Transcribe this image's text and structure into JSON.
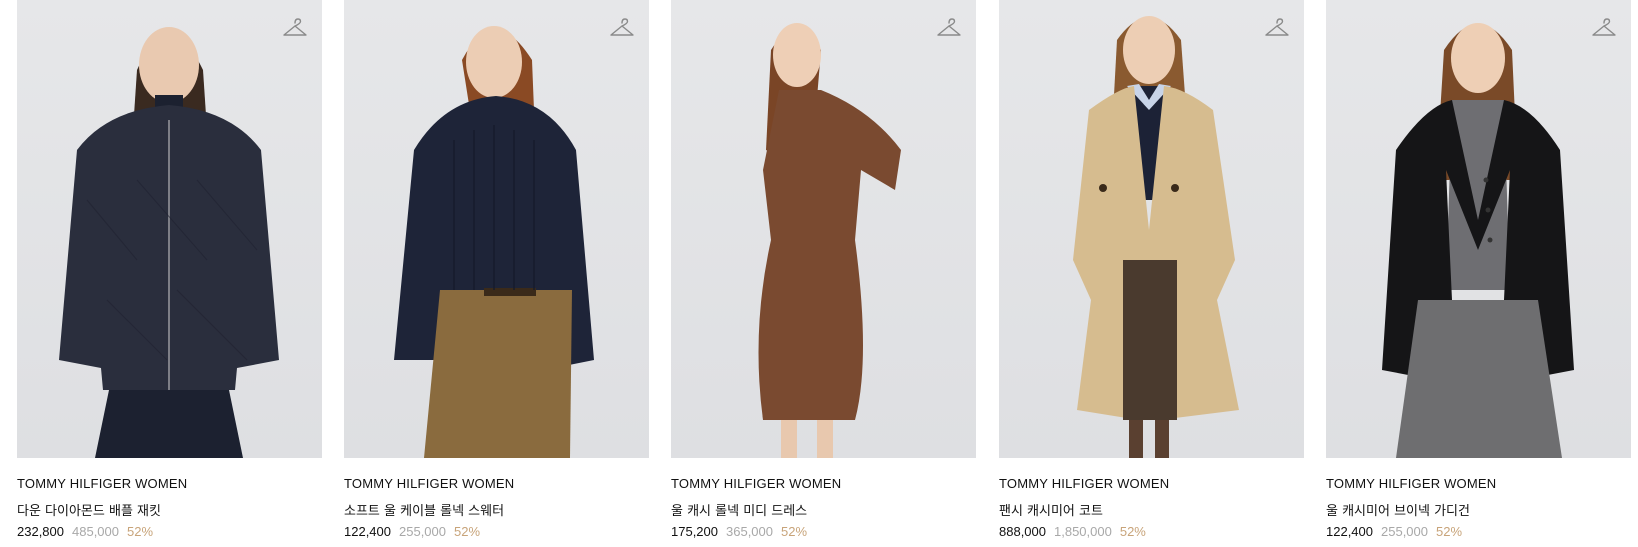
{
  "products": [
    {
      "brand": "TOMMY HILFIGER WOMEN",
      "name": "다운 다이아몬드 배플 재킷",
      "price": "232,800",
      "original_price": "485,000",
      "discount": "52%",
      "garment_color": "#2a2e3d",
      "bottom_color": "#1c2130"
    },
    {
      "brand": "TOMMY HILFIGER WOMEN",
      "name": "소프트 울 케이블 롤넥 스웨터",
      "price": "122,400",
      "original_price": "255,000",
      "discount": "52%",
      "garment_color": "#1e2438",
      "bottom_color": "#8a6b3e"
    },
    {
      "brand": "TOMMY HILFIGER WOMEN",
      "name": "울 캐시 롤넥 미디 드레스",
      "price": "175,200",
      "original_price": "365,000",
      "discount": "52%",
      "garment_color": "#7a4a30",
      "bottom_color": "#7a4a30"
    },
    {
      "brand": "TOMMY HILFIGER WOMEN",
      "name": "팬시 캐시미어 코트",
      "price": "888,000",
      "original_price": "1,850,000",
      "discount": "52%",
      "garment_color": "#d6bc8f",
      "bottom_color": "#4a3a2e"
    },
    {
      "brand": "TOMMY HILFIGER WOMEN",
      "name": "울 캐시미어 브이넥 가디건",
      "price": "122,400",
      "original_price": "255,000",
      "discount": "52%",
      "garment_color": "#151517",
      "bottom_color": "#6e6e70"
    }
  ],
  "icons": {
    "wishlist": "hanger-icon"
  }
}
